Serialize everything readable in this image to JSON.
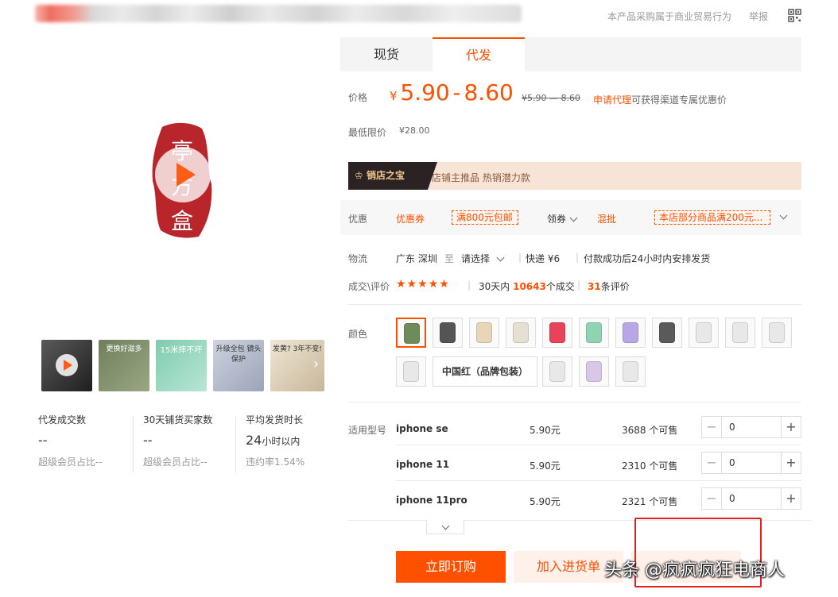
{
  "header": {
    "note": "本产品采购属于商业贸易行为",
    "report": "举报"
  },
  "tabs": [
    {
      "label": "现货",
      "active": false
    },
    {
      "label": "代发",
      "active": true
    }
  ],
  "price": {
    "label": "价格",
    "yen": "¥",
    "low": "5.90",
    "dash": "-",
    "high": "8.60",
    "original": "¥5.90 — 8.60",
    "agent_link": "申请代理",
    "agent_text": "可获得渠道专属优惠价",
    "min_label": "最低限价",
    "min_value": "¥28.00"
  },
  "banner": {
    "badge": "销店之宝",
    "text": "店铺主推品   热销潜力款"
  },
  "promo": {
    "label": "优惠",
    "coupon": "优惠券",
    "tag1": "满800元包邮",
    "get": "领券",
    "mix": "混批",
    "tag2": "本店部分商品满200元..."
  },
  "logistics": {
    "label": "物流",
    "from": "广东 深圳",
    "to": "至",
    "select": "请选择",
    "express": "快递 ¥6",
    "note": "付款成功后24小时内安排发货"
  },
  "deals": {
    "label": "成交\\评价",
    "stars": "★★★★★",
    "days_prefix": "30天内",
    "count": "10643",
    "days_suffix": "个成交",
    "reviews": "31",
    "reviews_suffix": "条评价"
  },
  "colors": {
    "label": "颜色",
    "text_option": "中国红（品牌包装）",
    "swatches": [
      "#6e8b5a",
      "#555555",
      "#e8d6b8",
      "#e6e0d2",
      "#e8435a",
      "#8fd3b4",
      "#b9a6e6",
      "#5a5a5a",
      "#e8e8e8",
      "#e8e8e8",
      "#e8e8e8",
      "#e8e8e8",
      "#e8e8e8",
      "#d9c7e8",
      "#e8e8e8"
    ]
  },
  "models": {
    "label": "适用型号",
    "rows": [
      {
        "name": "iphone se",
        "price": "5.90元",
        "stock": "3688 个可售",
        "qty": "0"
      },
      {
        "name": "iphone 11",
        "price": "5.90元",
        "stock": "2310 个可售",
        "qty": "0"
      },
      {
        "name": "iphone 11pro",
        "price": "5.90元",
        "stock": "2321 个可售",
        "qty": "0"
      }
    ]
  },
  "actions": {
    "buy": "立即订购",
    "cart": "加入进货单"
  },
  "watermark": "头条 @疯疯疯狂电商人",
  "left": {
    "seal_text": "亭 方 盒",
    "thumbs": [
      {
        "text": "",
        "bg": "#3b3b3b"
      },
      {
        "text": "更换好滋多",
        "bg": "#7d8a6a"
      },
      {
        "text": "15米摔不坏",
        "bg": "#8fcfb7"
      },
      {
        "text": "升级全包 镜头保护",
        "bg": "#d8d8e0"
      },
      {
        "text": "发黄? 3年不变!",
        "bg": "#e8ddc9"
      }
    ],
    "stats": [
      {
        "label": "代发成交数",
        "value": "--",
        "sub": "超级会员占比--"
      },
      {
        "label": "30天铺货买家数",
        "value": "--",
        "sub": "超级会员占比--"
      },
      {
        "label": "平均发货时长",
        "value": "24",
        "unit": "小时以内",
        "sub": "违约率1.54%"
      }
    ]
  }
}
